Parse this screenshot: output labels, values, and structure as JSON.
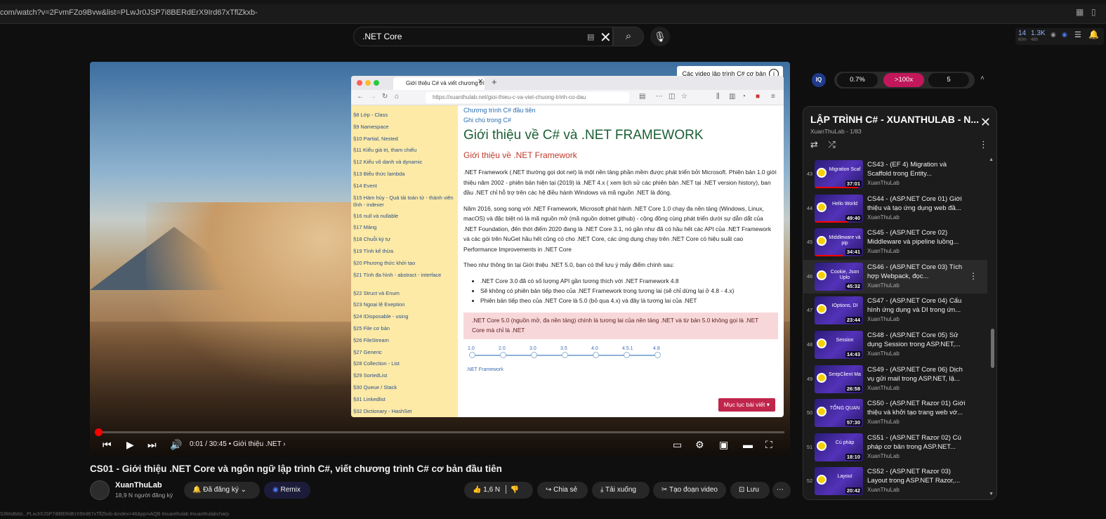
{
  "browser": {
    "url": "com/watch?v=2FvmFZo9Bvw&list=PLwJr0JSP7i8BERdErX9Ird67xTflZkxb-",
    "stats": {
      "count_a": "14",
      "count_a_sub": "60m",
      "count_b": "1.3K",
      "count_b_sub": "48h"
    }
  },
  "search": {
    "query": ".NET Core"
  },
  "player": {
    "overlay_text": "Các video lập trình C# cơ bản",
    "time": "0:01 / 30:45",
    "chapter": "• Giới thiệu .NET",
    "progress_fraction": 0.001,
    "inner_browser": {
      "tab_title": "Giới thiệu C# và viết chương trình",
      "url": "https://xuanthulab.net/gioi-thieu-c-va-viet-chuong-trinh-co-dau",
      "toc": [
        "§8 Lớp - Class",
        "§9 Namespace",
        "§10 Partial, Nested",
        "§11 Kiểu giá trị, tham chiếu",
        "§12 Kiểu vô danh và dynamic",
        "§13 Biểu thức lambda",
        "§14 Event",
        "§15 Hàm hủy - Quá tải toán tử - thành viên tĩnh - indexer",
        "§16 null và nullable",
        "§17 Mảng",
        "§18 Chuỗi ký tự",
        "§19 Tính kế thừa",
        "§20 Phương thức khởi tạo",
        "§21 Tính đa hình - abstract - interface",
        "§22 Struct và Enum",
        "§23 Ngoại lệ Exeption",
        "§24 IDisposable - using",
        "§25 File cơ bản",
        "§26 FileStream",
        "§27 Generic",
        "§28 Collection - List",
        "§29 SortedList",
        "§30 Queue / Stack",
        "§31 Linkedlist",
        "§32 Dictionary - HashSet"
      ],
      "links": [
        "Chương trình C# đầu tiên",
        "Ghi chú trong C#"
      ],
      "h1": "Giới thiệu về C# và .NET FRAMEWORK",
      "h2": "Giới thiệu về .NET Framework",
      "p1": ".NET Framework (.NET thường gọi dot net) là một nền tảng phần mềm được phát triển bởi Microsoft. Phiên bản 1.0 giới thiệu năm 2002 - phiên bản hiện tại (2019) là .NET 4.x ( xem lịch sử các phiên bản .NET tại .NET version history), ban đầu .NET chỉ hỗ trợ trên các hệ điều hành Windows và mã nguồn .NET là đóng.",
      "p2": "Năm 2016, song song với .NET Framework, Microsoft phát hành .NET Core 1.0 chạy đa nền tảng (Windows, Linux, macOS) và đặc biệt nó là mã nguồn mở (mã nguồn dotnet github) - cộng đồng cùng phát triển dưới sự dẫn dắt của .NET Foundation, đến thời điểm 2020 đang là .NET Core 3.1, nó gần như đã có hầu hết các API của .NET Framework và các gói trên NuGet hầu hết cũng có cho .NET Core, các ứng dụng chạy trên .NET Core có hiệu suất cao Performance Improvements in .NET Core",
      "p3": "Theo như thông tin tại Giới thiệu .NET 5.0, bạn có thể lưu ý mấy điểm chính sau:",
      "bullets": [
        ".NET Core 3.0 đã có số lượng API gần tương thích với .NET Framework 4.8",
        "Sẽ không có phiên bản tiếp theo của .NET Framework trong tương lai (sẽ chỉ dừng lại ở 4.8 - 4.x)",
        "Phiên bản tiếp theo của .NET Core là 5.0 (bỏ qua 4.x) và đây là tương lai của .NET"
      ],
      "callout": ".NET Core 5.0 (nguồn mở, đa nền tảng) chính là tương lai của nền tảng .NET và từ bản 5.0 không gọi là .NET Core mà chỉ là .NET",
      "timeline_versions": [
        "1.0",
        "2.0",
        "3.0",
        "3.5",
        "4.0",
        "4.5.1",
        "4.8"
      ],
      "timeline_label": ".NET Framework",
      "toc_button": "Mục lục bài viết"
    }
  },
  "video": {
    "title": "CS01 - Giới thiệu .NET Core và ngôn ngữ lập trình C#, viết chương trình C# cơ bản đầu tiên",
    "channel": "XuanThuLab",
    "subscribers": "18,9 N người đăng ký",
    "subscribed_label": "Đã đăng ký",
    "remix_label": "Remix",
    "likes": "1,6 N",
    "share_label": "Chia sẻ",
    "download_label": "Tải xuống",
    "clip_label": "Tạo đoạn video",
    "save_label": "Lưu"
  },
  "iq": {
    "speed": "0.7%",
    "mult": ">100x",
    "count": "5"
  },
  "playlist": {
    "title": "LẬP TRÌNH C# - XUANTHULAB - N...",
    "subtitle": "XuanThuLab - 1/83",
    "items": [
      {
        "idx": "43",
        "title": "CS43 - (EF 4) Migration và Scaffold trong Entity...",
        "channel": "XuanThuLab",
        "dur": "37:01",
        "thumb": "Migration Scaf",
        "active": false,
        "watched": 0.9
      },
      {
        "idx": "44",
        "title": "CS44 - (ASP.NET Core 01) Giới thiệu và tạo ứng dụng web đầ...",
        "channel": "XuanThuLab",
        "dur": "49:40",
        "thumb": "Hello World",
        "active": false,
        "watched": 0.7
      },
      {
        "idx": "45",
        "title": "CS45 - (ASP.NET Core 02) Middleware và pipeline luồng...",
        "channel": "XuanThuLab",
        "dur": "34:41",
        "thumb": "Middleware và pip",
        "active": false,
        "watched": 0.6
      },
      {
        "idx": "46",
        "title": "CS46 - (ASP.NET Core 03) Tích hợp Webpack, đọc...",
        "channel": "XuanThuLab",
        "dur": "45:32",
        "thumb": "Cookie, Json Uplo",
        "active": true,
        "watched": 0.0
      },
      {
        "idx": "47",
        "title": "CS47 - (ASP.NET Core 04) Cấu hình ứng dụng và DI trong ứn...",
        "channel": "XuanThuLab",
        "dur": "23:44",
        "thumb": "IOptions, DI",
        "active": false,
        "watched": 0.0
      },
      {
        "idx": "48",
        "title": "CS48 - (ASP.NET Core 05) Sử dụng Session trong ASP.NET,...",
        "channel": "XuanThuLab",
        "dur": "14:43",
        "thumb": "Session",
        "active": false,
        "watched": 0.0
      },
      {
        "idx": "49",
        "title": "CS49 - (ASP.NET Core 06) Dịch vụ gửi mail trong ASP.NET, lậ...",
        "channel": "XuanThuLab",
        "dur": "26:58",
        "thumb": "SmtpClient Ma",
        "active": false,
        "watched": 0.0
      },
      {
        "idx": "50",
        "title": "CS50 - (ASP.NET Razor 01) Giới thiệu và khởi tạo trang web vớ...",
        "channel": "XuanThuLab",
        "dur": "57:30",
        "thumb": "TỔNG QUAN",
        "active": false,
        "watched": 0.0
      },
      {
        "idx": "51",
        "title": "CS51 - (ASP.NET Razor 02) Cú pháp cơ bản trong ASP.NET...",
        "channel": "XuanThuLab",
        "dur": "18:10",
        "thumb": "Cú pháp",
        "active": false,
        "watched": 0.0
      },
      {
        "idx": "52",
        "title": "CS52 - (ASP.NET Razor 03) Layout trong ASP.NET Razor,...",
        "channel": "XuanThuLab",
        "dur": "20:42",
        "thumb": "Layout",
        "active": false,
        "watched": 0.0
      }
    ]
  },
  "footer_note": "S3MoBdst...PLwJr0JSP7i8BERdErX9Ird67xTflZkxb-&index=46&pp=iAQB  #xuanthulab #xuanthulabcharp",
  "colors": {
    "background": "#0f0f0f",
    "accent_red": "#ff0000",
    "iq_pink": "#c2185b"
  }
}
